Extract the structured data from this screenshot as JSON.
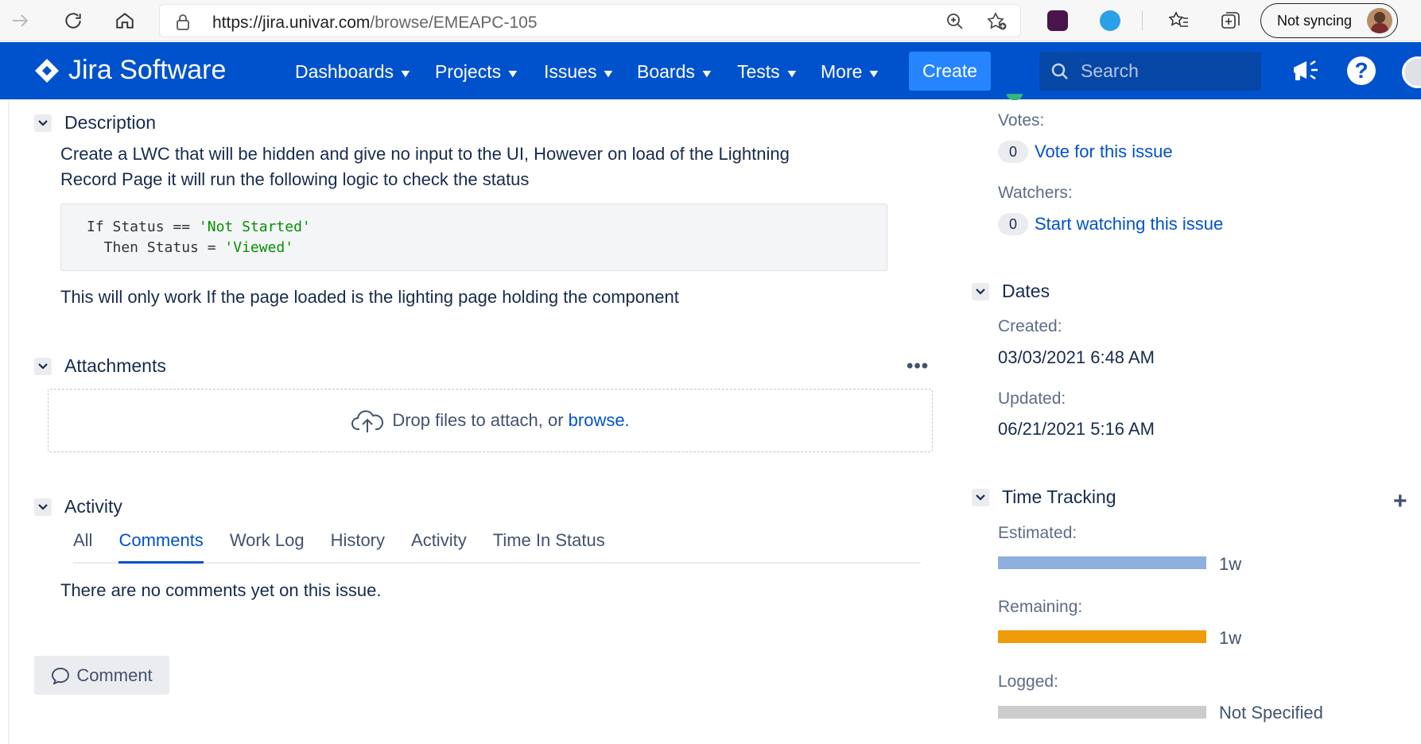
{
  "browser": {
    "url_host": "https://jira.univar.com",
    "url_path": "/browse/EMEAPC-105",
    "sync_label": "Not syncing"
  },
  "nav": {
    "logo": "Jira Software",
    "items": [
      "Dashboards",
      "Projects",
      "Issues",
      "Boards",
      "Tests",
      "More"
    ],
    "create": "Create",
    "search_placeholder": "Search"
  },
  "description": {
    "heading": "Description",
    "line1": "Create a LWC that will be hidden and give no input to the UI, However on load of the Lightning",
    "line2": "Record Page it will run the following logic to check the status",
    "code_line1_pre": "If Status == ",
    "code_line1_str": "'Not Started'",
    "code_line2_pre": "  Then Status = ",
    "code_line2_str": "'Viewed'",
    "footer": "This will only work If the page loaded is the lighting page holding the component"
  },
  "attachments": {
    "heading": "Attachments",
    "drop_text": "Drop files to attach, or ",
    "browse": "browse."
  },
  "activity": {
    "heading": "Activity",
    "tabs": [
      "All",
      "Comments",
      "Work Log",
      "History",
      "Activity",
      "Time In Status"
    ],
    "active_tab": "Comments",
    "empty": "There are no comments yet on this issue.",
    "comment_button": "Comment"
  },
  "people": {
    "votes_label": "Votes:",
    "votes_count": "0",
    "vote_link": "Vote for this issue",
    "watchers_label": "Watchers:",
    "watchers_count": "0",
    "watch_link": "Start watching this issue"
  },
  "dates": {
    "heading": "Dates",
    "created_label": "Created:",
    "created": "03/03/2021 6:48 AM",
    "updated_label": "Updated:",
    "updated": "06/21/2021 5:16 AM"
  },
  "time_tracking": {
    "heading": "Time Tracking",
    "estimated_label": "Estimated:",
    "estimated": "1w",
    "estimated_fraction": 1.0,
    "estimated_color": "#8fb0de",
    "remaining_label": "Remaining:",
    "remaining": "1w",
    "remaining_fraction": 1.0,
    "remaining_color": "#f09b0a",
    "logged_label": "Logged:",
    "logged": "Not Specified",
    "logged_fraction": 0.0,
    "logged_track_color": "#cccccc"
  }
}
